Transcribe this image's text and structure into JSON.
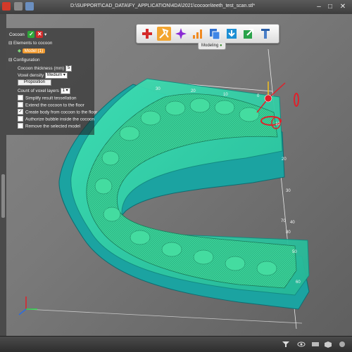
{
  "window": {
    "title": "D:\\SUPPORT\\CAD_DATA\\FY_APPLICATION\\4DA\\2021\\cocoon\\teeth_test_scan.stl*",
    "minimize": "–",
    "maximize": "□",
    "close": "✕"
  },
  "panel": {
    "title": "Cocoon",
    "validate": "✓",
    "cancel": "✕",
    "dropdown": "▾",
    "elements_header": "Elements to cocoon",
    "model_tag": "Model (1)",
    "configuration_header": "Configuration",
    "thickness_label": "Cocoon thickness (mm)",
    "thickness_value": "5",
    "voxel_density_label": "Voxel density",
    "voxel_density_value": "Medium",
    "proposition_button": "Proposition",
    "voxel_layers_label": "Count of voxel layers",
    "voxel_layers_value": "1",
    "options": [
      {
        "label": "Simplify result tessellation",
        "checked": false
      },
      {
        "label": "Extend the cocoon to the floor",
        "checked": false
      },
      {
        "label": "Create body from cocoon to the floor",
        "checked": true
      },
      {
        "label": "Authorize bubble inside the cocoon",
        "checked": false
      },
      {
        "label": "Remove the selected model",
        "checked": false
      }
    ]
  },
  "toolbar": {
    "tools": [
      "add-tool",
      "sculpt-tool",
      "sparkle-tool",
      "bar-chart-tool",
      "copy-tool",
      "download-tool",
      "export-tool",
      "measure-tool"
    ],
    "active_tool": "sculpt-tool",
    "mode_label": "Modeling"
  },
  "ruler": {
    "top_ticks": [
      "30",
      "20",
      "10",
      "0"
    ],
    "right_ticks": [
      "10",
      "20",
      "30",
      "40",
      "50",
      "60"
    ],
    "bottom_ticks": [
      "10",
      "20",
      "30",
      "40",
      "50",
      "60",
      "70",
      "80"
    ]
  },
  "colors": {
    "cocoon_shell": "#2bc6a4",
    "cocoon_side": "#1ba3a1",
    "teeth_mesh": "#3fd99a",
    "gizmo_red": "#e0202a",
    "gizmo_yellow": "#f2c020",
    "accent_orange": "#f2a531",
    "viewport_bg": "#7a7a7a"
  }
}
